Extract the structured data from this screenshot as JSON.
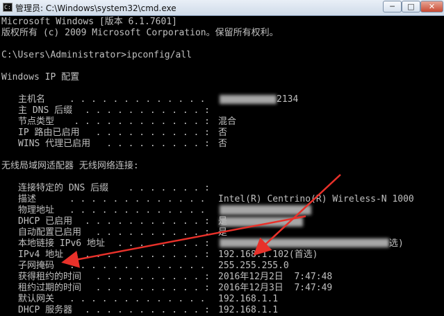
{
  "window": {
    "title": "管理员: C:\\Windows\\system32\\cmd.exe",
    "icon": "cmd-icon",
    "min_label": "─",
    "max_label": "□",
    "close_label": "✕"
  },
  "console": {
    "header1": "Microsoft Windows [版本 6.1.7601]",
    "header2": "版权所有 (c) 2009 Microsoft Corporation。保留所有权利。",
    "prompt": "C:\\Users\\Administrator>ipconfig/all",
    "section1": "Windows IP 配置",
    "section2": "无线局域网适配器 无线网络连接:",
    "rows1": [
      {
        "label": "主机名",
        "dots": " . . . . . . . . . . . . . :",
        "value": "2134"
      },
      {
        "label": "主 DNS 后缀",
        "dots": " . . . . . . . . . . . :",
        "value": ""
      },
      {
        "label": "节点类型",
        "dots": " . . . . . . . . . . . . :",
        "value": "混合"
      },
      {
        "label": "IP 路由已启用",
        "dots": " . . . . . . . . . . :",
        "value": "否"
      },
      {
        "label": "WINS 代理已启用",
        "dots": " . . . . . . . . . :",
        "value": "否"
      }
    ],
    "rows2": [
      {
        "label": "连接特定的 DNS 后缀",
        "dots": " . . . . . . . :",
        "value": ""
      },
      {
        "label": "描述",
        "dots": " . . . . . . . . . . . . . . . :",
        "value": "Intel(R) Centrino(R) Wireless-N 1000"
      },
      {
        "label": "物理地址",
        "dots": " . . . . . . . . . . . . . :",
        "value": ""
      },
      {
        "label": "DHCP 已启用",
        "dots": " . . . . . . . . . . . :",
        "value": "是"
      },
      {
        "label": "自动配置已启用",
        "dots": " . . . . . . . . . . :",
        "value": "是"
      },
      {
        "label": "本地链接 IPv6 地址",
        "dots": " . . . . . . . . :",
        "value": "选)"
      },
      {
        "label": "IPv4 地址",
        "dots": " . . . . . . . . . . . . :",
        "value": "192.168.1.102(首选)"
      },
      {
        "label": "子网掩码",
        "dots": " . . . . . . . . . . . . . :",
        "value": "255.255.255.0"
      },
      {
        "label": "获得租约的时间",
        "dots": " . . . . . . . . . . :",
        "value": "2016年12月2日  7:47:48"
      },
      {
        "label": "租约过期的时间",
        "dots": " . . . . . . . . . . :",
        "value": "2016年12月3日  7:47:49"
      },
      {
        "label": "默认网关",
        "dots": " . . . . . . . . . . . . . :",
        "value": "192.168.1.1"
      },
      {
        "label": "DHCP 服务器",
        "dots": " . . . . . . . . . . . :",
        "value": "192.168.1.1"
      }
    ]
  },
  "colors": {
    "console_bg": "#000000",
    "console_text": "#c0c0c0",
    "annotation_arrow": "#e8312a",
    "close_button": "#c84a33"
  }
}
